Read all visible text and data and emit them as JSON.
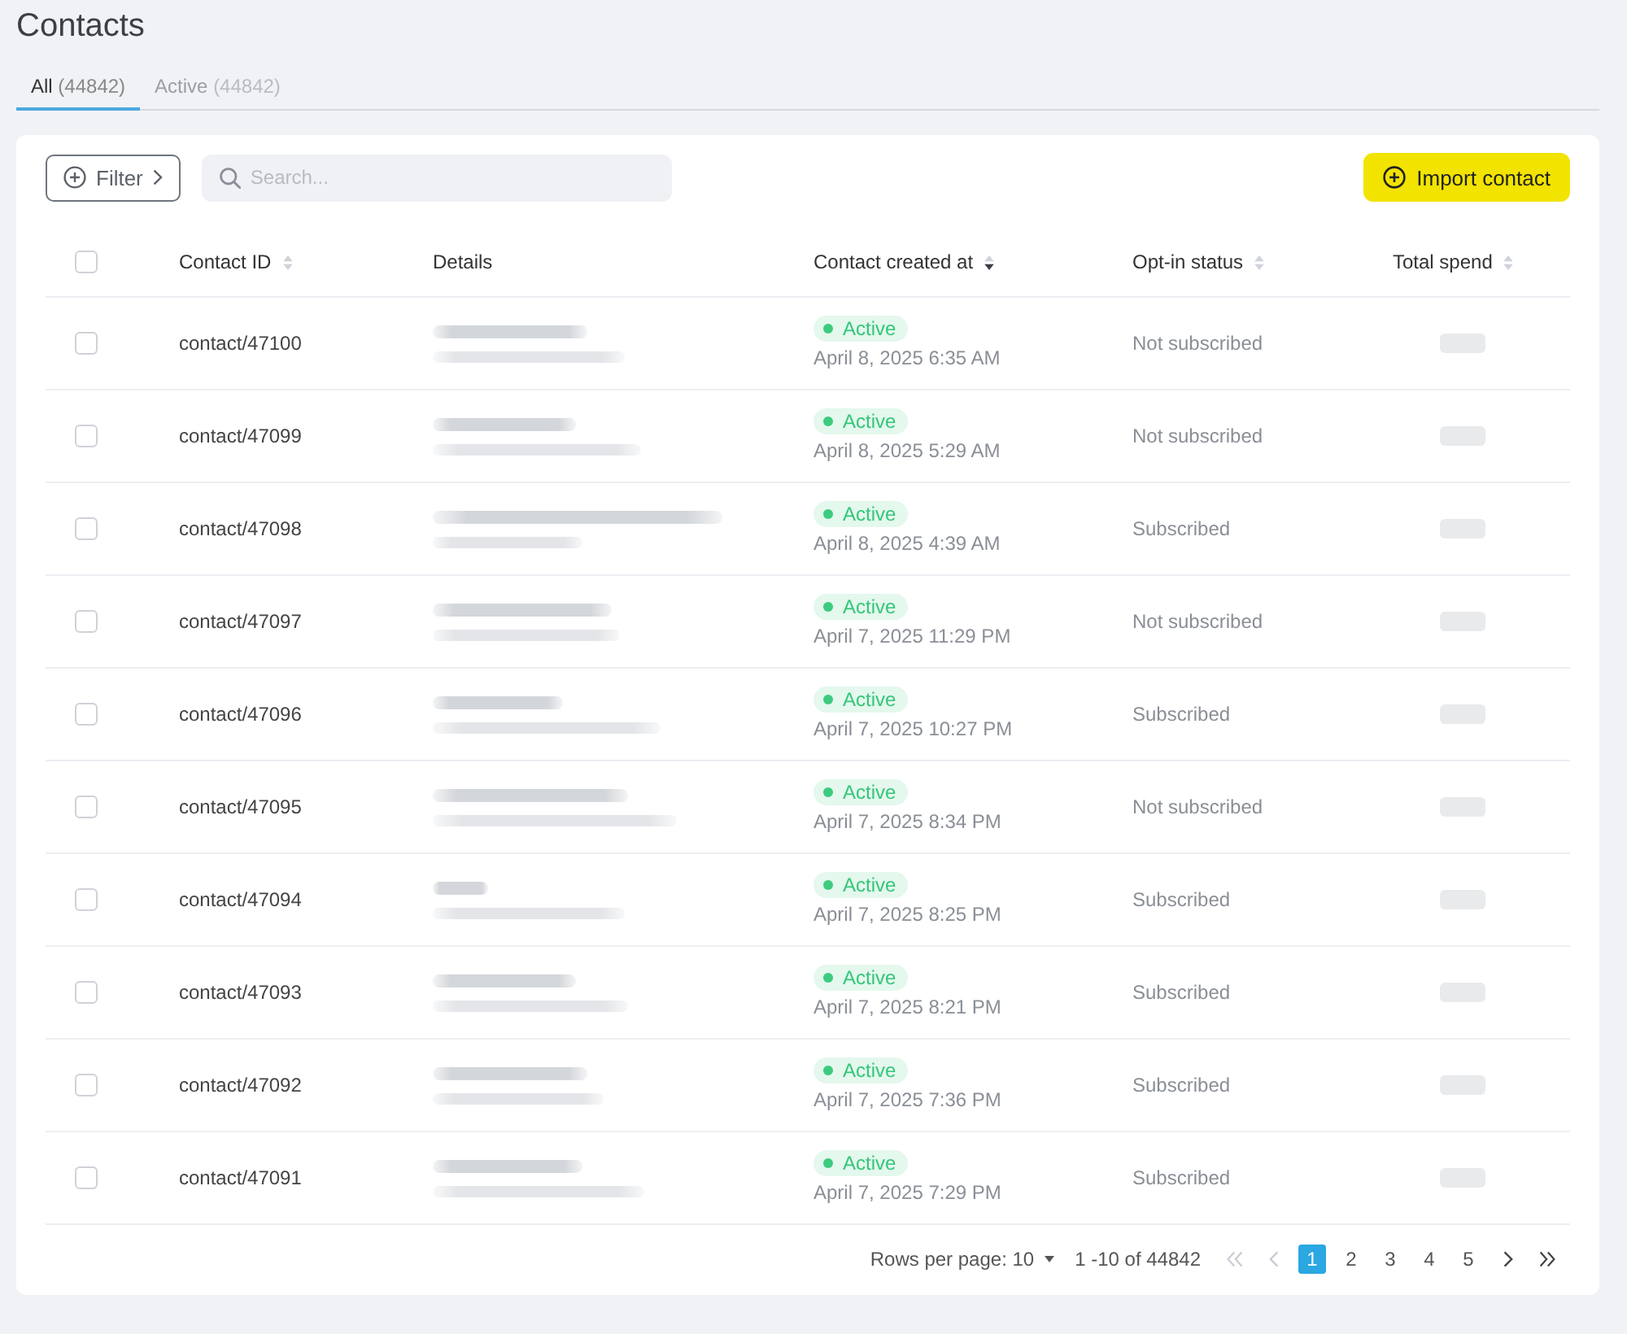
{
  "page": {
    "title": "Contacts"
  },
  "tabs": [
    {
      "label": "All",
      "count": "(44842)",
      "selected": true
    },
    {
      "label": "Active",
      "count": "(44842)",
      "selected": false
    }
  ],
  "toolbar": {
    "filter_button": "Filter",
    "search": {
      "placeholder": "Search..."
    },
    "import_button": "Import contact"
  },
  "table": {
    "select_all": {
      "checked": false
    },
    "columns": [
      {
        "label": "Contact ID",
        "sortable": true,
        "sorted_descending": false
      },
      {
        "label": "Details",
        "sortable": false
      },
      {
        "label": "Contact created at",
        "sortable": true,
        "sorted_descending": true
      },
      {
        "label": "Opt-in status",
        "sortable": true,
        "sorted_descending": false
      },
      {
        "label": "Total spend",
        "sortable": true,
        "sorted_descending": false
      }
    ],
    "rows": [
      {
        "checked": false,
        "contact_id": "contact/47100",
        "status": "Active",
        "created_at": "April 8, 2025 6:35 AM",
        "opt_in": "Not subscribed"
      },
      {
        "checked": false,
        "contact_id": "contact/47099",
        "status": "Active",
        "created_at": "April 8, 2025 5:29 AM",
        "opt_in": "Not subscribed"
      },
      {
        "checked": false,
        "contact_id": "contact/47098",
        "status": "Active",
        "created_at": "April 8, 2025 4:39 AM",
        "opt_in": "Subscribed"
      },
      {
        "checked": false,
        "contact_id": "contact/47097",
        "status": "Active",
        "created_at": "April 7, 2025 11:29 PM",
        "opt_in": "Not subscribed"
      },
      {
        "checked": false,
        "contact_id": "contact/47096",
        "status": "Active",
        "created_at": "April 7, 2025 10:27 PM",
        "opt_in": "Subscribed"
      },
      {
        "checked": false,
        "contact_id": "contact/47095",
        "status": "Active",
        "created_at": "April 7, 2025 8:34 PM",
        "opt_in": "Not subscribed"
      },
      {
        "checked": false,
        "contact_id": "contact/47094",
        "status": "Active",
        "created_at": "April 7, 2025 8:25 PM",
        "opt_in": "Subscribed"
      },
      {
        "checked": false,
        "contact_id": "contact/47093",
        "status": "Active",
        "created_at": "April 7, 2025 8:21 PM",
        "opt_in": "Subscribed"
      },
      {
        "checked": false,
        "contact_id": "contact/47092",
        "status": "Active",
        "created_at": "April 7, 2025 7:36 PM",
        "opt_in": "Subscribed"
      },
      {
        "checked": false,
        "contact_id": "contact/47091",
        "status": "Active",
        "created_at": "April 7, 2025 7:29 PM",
        "opt_in": "Subscribed"
      }
    ]
  },
  "pagination": {
    "rows_per_page_label": "Rows per page:",
    "rows_per_page": "10",
    "range": "1 -10 of 44842",
    "first": {
      "disabled": true
    },
    "prev": {
      "disabled": true
    },
    "pages": [
      {
        "label": "1",
        "selected": true
      },
      {
        "label": "2",
        "selected": false
      },
      {
        "label": "3",
        "selected": false
      },
      {
        "label": "4",
        "selected": false
      },
      {
        "label": "5",
        "selected": false
      }
    ],
    "next": {
      "disabled": false
    },
    "last": {
      "disabled": false
    }
  }
}
